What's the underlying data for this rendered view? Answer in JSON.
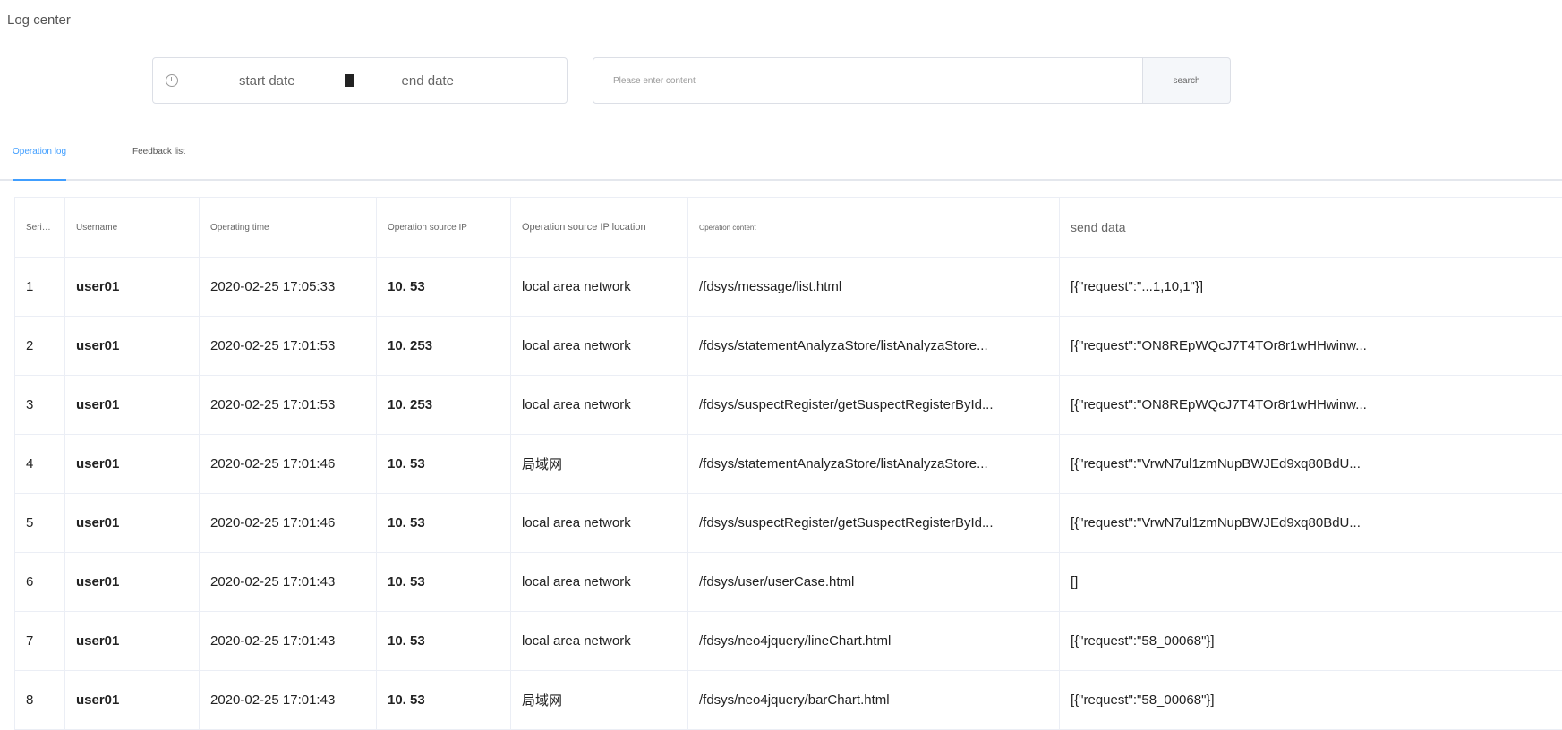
{
  "page": {
    "title": "Log center"
  },
  "filters": {
    "start_date_placeholder": "start date",
    "end_date_placeholder": "end date",
    "content_placeholder": "Please enter content",
    "search_label": "search"
  },
  "tabs": [
    {
      "label": "Operation log",
      "active": true
    },
    {
      "label": "Feedback list",
      "active": false
    }
  ],
  "table": {
    "headers": {
      "serial": "Serial number",
      "username": "Username",
      "time": "Operating time",
      "ip": "Operation source IP",
      "location": "Operation source IP location",
      "content": "Operation content",
      "send_data": "send data"
    },
    "rows": [
      {
        "serial": "1",
        "username": "user01",
        "time": "2020-02-25 17:05:33",
        "ip": "10.   53",
        "location": "local area network",
        "content": "/fdsys/message/list.html",
        "send_data": "[{\"request\":\"...1,10,1\"}]"
      },
      {
        "serial": "2",
        "username": "user01",
        "time": "2020-02-25 17:01:53",
        "ip": "10.   253",
        "location": "local area network",
        "content": "/fdsys/statementAnalyzaStore/listAnalyzaStore...",
        "send_data": "[{\"request\":\"ON8REpWQcJ7T4TOr8r1wHHwinw..."
      },
      {
        "serial": "3",
        "username": "user01",
        "time": "2020-02-25 17:01:53",
        "ip": "10.   253",
        "location": "local area network",
        "content": "/fdsys/suspectRegister/getSuspectRegisterById...",
        "send_data": "[{\"request\":\"ON8REpWQcJ7T4TOr8r1wHHwinw..."
      },
      {
        "serial": "4",
        "username": "user01",
        "time": "2020-02-25 17:01:46",
        "ip": "10.   53",
        "location": "局域网",
        "content": "/fdsys/statementAnalyzaStore/listAnalyzaStore...",
        "send_data": "[{\"request\":\"VrwN7ul1zmNupBWJEd9xq80BdU..."
      },
      {
        "serial": "5",
        "username": "user01",
        "time": "2020-02-25 17:01:46",
        "ip": "10.   53",
        "location": "local area network",
        "content": "/fdsys/suspectRegister/getSuspectRegisterById...",
        "send_data": "[{\"request\":\"VrwN7ul1zmNupBWJEd9xq80BdU..."
      },
      {
        "serial": "6",
        "username": "user01",
        "time": "2020-02-25 17:01:43",
        "ip": "10.   53",
        "location": "local area network",
        "content": "/fdsys/user/userCase.html",
        "send_data": "[]"
      },
      {
        "serial": "7",
        "username": "user01",
        "time": "2020-02-25 17:01:43",
        "ip": "10.   53",
        "location": "local area network",
        "content": "/fdsys/neo4jquery/lineChart.html",
        "send_data": "[{\"request\":\"58_00068\"}]"
      },
      {
        "serial": "8",
        "username": "user01",
        "time": "2020-02-25 17:01:43",
        "ip": "10.   53",
        "location": "局域网",
        "content": "/fdsys/neo4jquery/barChart.html",
        "send_data": "[{\"request\":\"58_00068\"}]"
      }
    ]
  },
  "icons": {
    "date_icon": "clock-icon",
    "separator_icon": "calendar-icon"
  },
  "colors": {
    "accent": "#409eff",
    "border": "#ebeef5"
  }
}
